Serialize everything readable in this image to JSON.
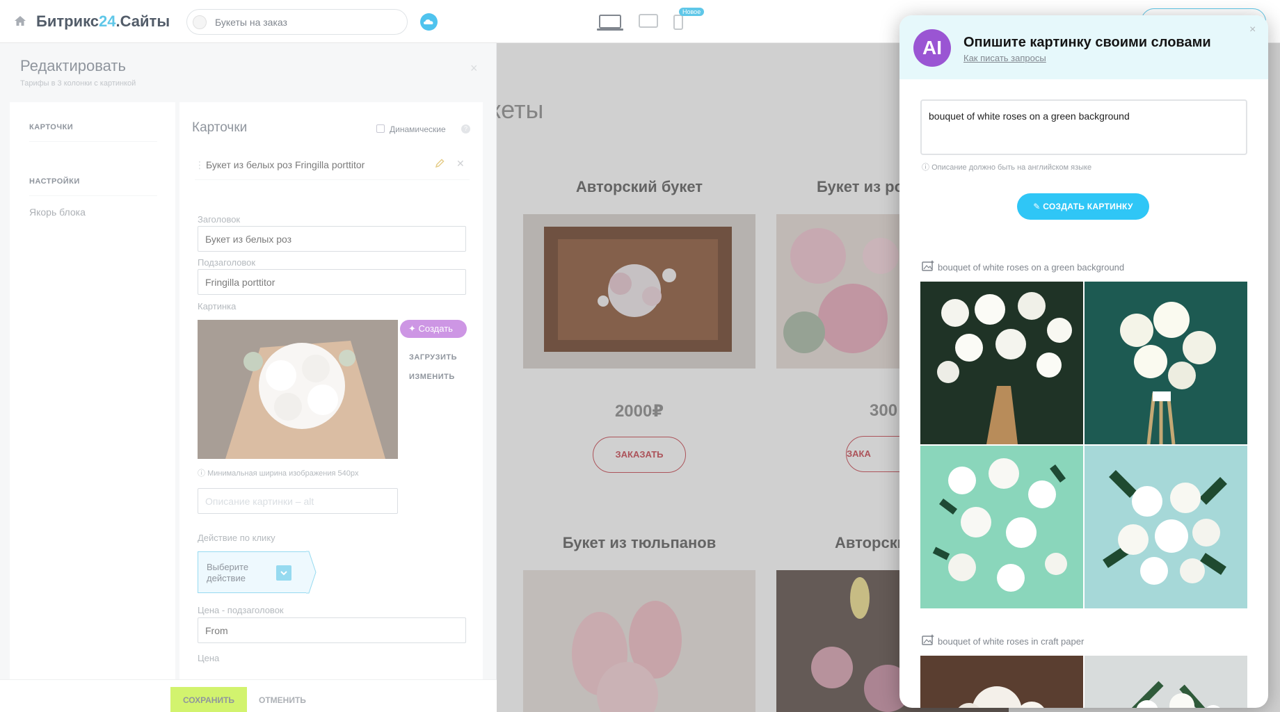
{
  "header": {
    "brand_main": "Битрикс",
    "brand_num": "24",
    "brand_suffix": ".Сайты",
    "site_name": "Букеты на заказ",
    "new_badge": "Новое"
  },
  "preview": {
    "title_fragment": "кеты",
    "cards": [
      {
        "title": "Авторский букет",
        "price": "2000₽",
        "button": "ЗАКАЗАТЬ"
      },
      {
        "title": "Букет из ро",
        "price": "300",
        "button": "ЗАКА"
      },
      {
        "title": "Букет из тюльпанов"
      },
      {
        "title": "Авторски"
      }
    ]
  },
  "editor": {
    "title": "Редактировать",
    "subtitle": "Тарифы в 3 колонки с картинкой",
    "close": "×",
    "nav": {
      "section_cards": "КАРТОЧКИ",
      "section_settings": "НАСТРОЙКИ",
      "anchor": "Якорь блока"
    },
    "panel_title": "Карточки",
    "dynamic_label": "Динамические",
    "help": "?",
    "card_item": "Букет из белых роз  Fringilla porttitor",
    "fields": {
      "heading_label": "Заголовок",
      "heading_value": "Букет из белых роз",
      "subheading_label": "Подзаголовок",
      "subheading_value": "Fringilla porttitor",
      "image_label": "Картинка",
      "create_button": "Создать",
      "upload_link": "ЗАГРУЗИТЬ",
      "change_link": "ИЗМЕНИТЬ",
      "min_width_hint": "Минимальная ширина изображения 540px",
      "alt_placeholder": "Описание картинки – alt",
      "click_action_label": "Действие по клику",
      "click_action_value_1": "Выберите",
      "click_action_value_2": "действие",
      "price_sub_label": "Цена - подзаголовок",
      "price_sub_value": "From",
      "price_label": "Цена"
    },
    "footer": {
      "save": "СОХРАНИТЬ",
      "cancel": "ОТМЕНИТЬ"
    }
  },
  "ai_panel": {
    "logo_text": "AI",
    "title": "Опишите картинку своими словами",
    "how_to_link": "Как писать запросы",
    "close": "×",
    "prompt_value": "bouquet of white roses on a green background",
    "note": "Описание должно быть на английском языке",
    "create_button": "СОЗДАТЬ КАРТИНКУ",
    "results": [
      {
        "caption": "bouquet of white roses on a green background"
      },
      {
        "caption": "bouquet of white roses in craft paper"
      }
    ]
  },
  "colors": {
    "brand_blue": "#2fc6f6",
    "save_green": "#bbed21",
    "ai_purple": "#b25fd6",
    "order_red": "#c8404a"
  }
}
